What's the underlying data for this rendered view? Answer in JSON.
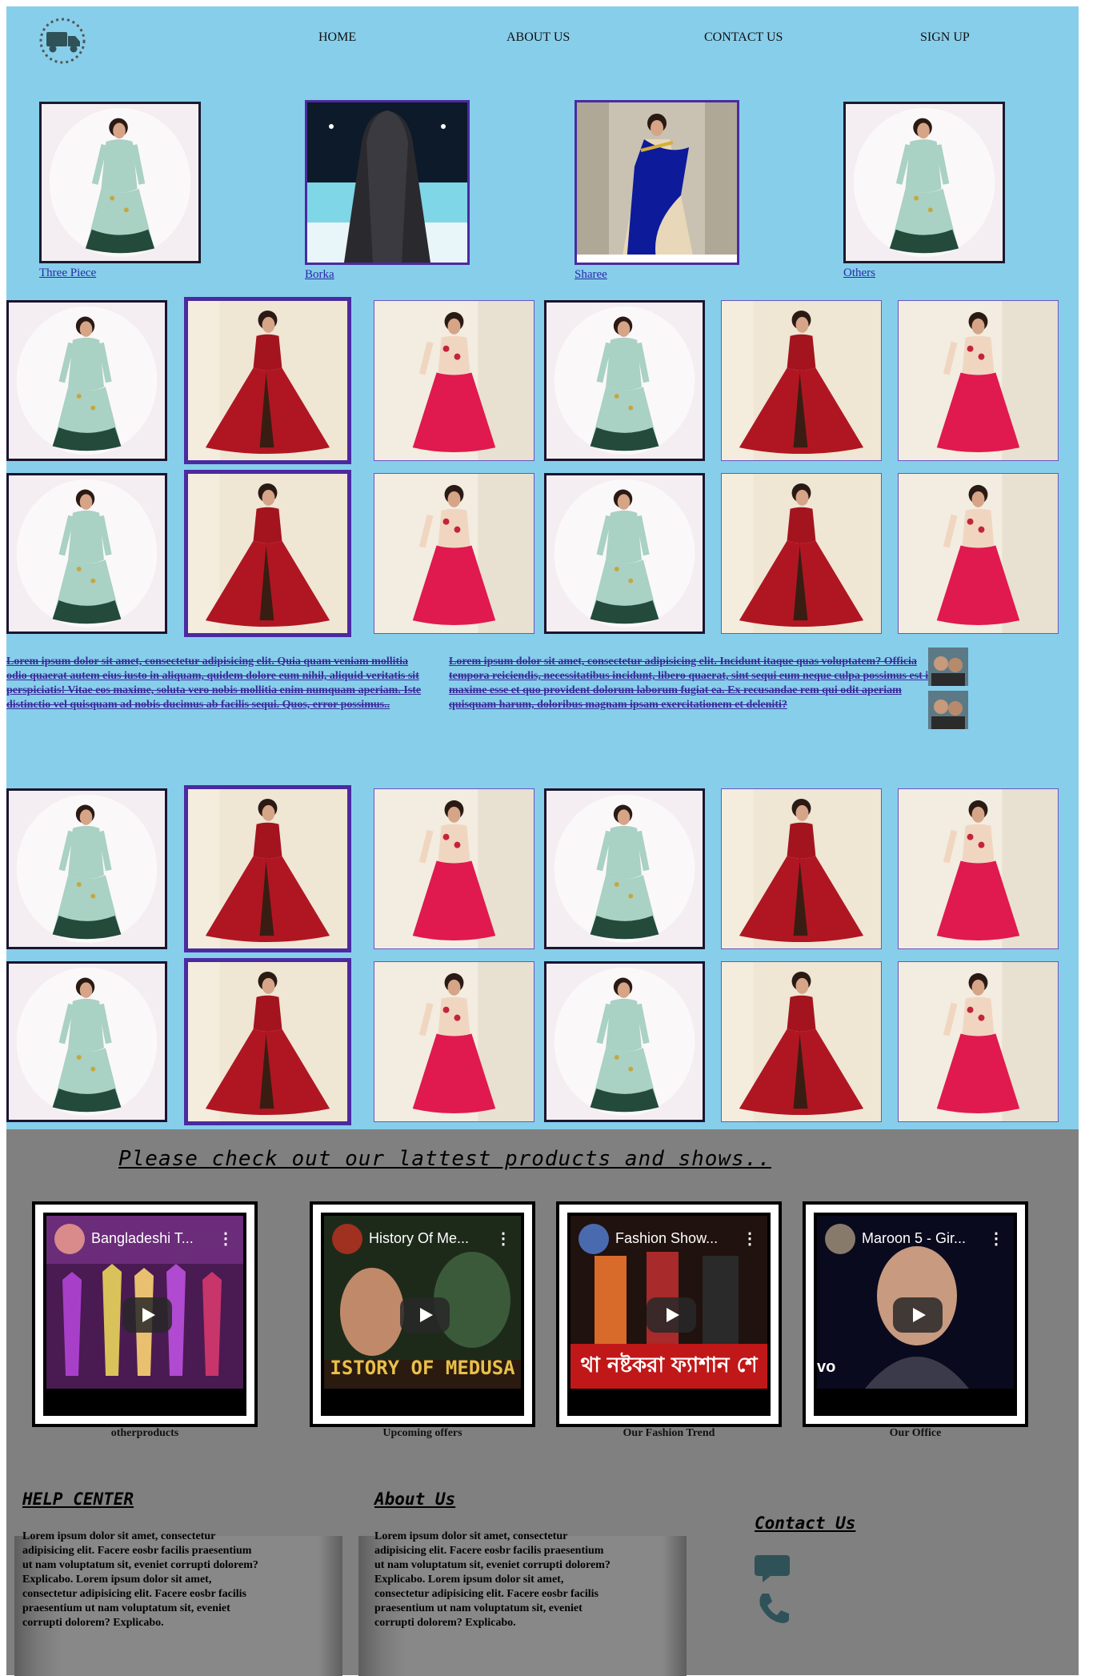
{
  "nav": {
    "logo_icon": "delivery-truck-icon",
    "items": [
      "HOME",
      "ABOUT US",
      "CONTACT US",
      "SIGN UP"
    ]
  },
  "categories": [
    {
      "label": "Three Piece",
      "image": "three-piece-dress"
    },
    {
      "label": "Borka",
      "image": "black-borka"
    },
    {
      "label": "Sharee",
      "image": "blue-saree"
    },
    {
      "label": "Others",
      "image": "three-piece-dress"
    }
  ],
  "lorem": {
    "left": "Lorem ipsum dolor sit amet, consectetur adipisicing elit. Quia quam veniam mollitia odio quaerat autem eius iusto in aliquam, quidem dolore eum nihil, aliquid veritatis sit perspiciatis! Vitae eos maxime, soluta vero nobis mollitia enim numquam aperiam. Iste distinctio vel quisquam ad nobis ducimus ab facilis sequi. Quos, error possimus..",
    "right": "Lorem ipsum dolor sit amet, consectetur adipisicing elit. Incidunt itaque quas voluptatem? Officia tempora reiciendis, necessitatibus incidunt, libero quaerat, sint sequi eum neque culpa possimus est in maxime esse et quo provident dolorum laborum fugiat ea. Ex recusandae rem qui odit aperiam quisquam harum, doloribus magnam ipsam exercitationem et deleniti?"
  },
  "promo_heading": "Please check out our lattest products and shows..",
  "videos": [
    {
      "title": "Bangladeshi T...",
      "caption": "otherproducts"
    },
    {
      "title": "History Of Me...",
      "caption": "Upcoming offers",
      "overlay": "ISTORY OF MEDUSA"
    },
    {
      "title": "Fashion Show...",
      "caption": "Our Fashion Trend",
      "overlay": "থা নষ্টকরা ফ্যাশান শে"
    },
    {
      "title": "Maroon 5 - Gir...",
      "caption": "Our Office",
      "overlay": "vo"
    }
  ],
  "footer": {
    "help_heading": "HELP CENTER",
    "about_heading": "About Us",
    "contact_heading": "Contact Us",
    "help_text": "Lorem ipsum dolor sit amet, consectetur adipisicing elit. Facere eosbr facilis praesentium ut nam voluptatum sit, eveniet corrupti dolorem? Explicabo. Lorem ipsum dolor sit amet, consectetur adipisicing elit. Facere eosbr facilis praesentium ut nam voluptatum sit, eveniet corrupti dolorem? Explicabo.",
    "about_text": "Lorem ipsum dolor sit amet, consectetur adipisicing elit. Facere eosbr facilis praesentium ut nam voluptatum sit, eveniet corrupti dolorem? Explicabo. Lorem ipsum dolor sit amet, consectetur adipisicing elit. Facere eosbr facilis praesentium ut nam voluptatum sit, eveniet corrupti dolorem? Explicabo.",
    "contact_icons": [
      "chat-bubble-icon",
      "phone-icon"
    ]
  },
  "colors": {
    "top_bg": "#87ceeb",
    "bottom_bg": "#808080",
    "link": "#2a2aa8",
    "accent_border": "#4b2aa0"
  }
}
